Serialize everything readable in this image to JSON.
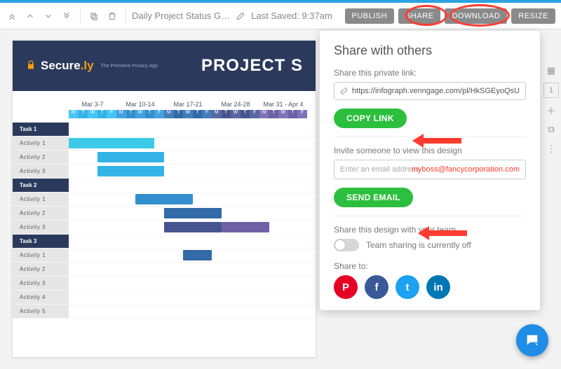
{
  "toolbar": {
    "doc_title": "Daily Project Status G…",
    "last_saved": "Last Saved: 9:37am"
  },
  "actions": {
    "publish": "PUBLISH",
    "share": "SHARE",
    "download": "DOWNLOAD",
    "resize": "RESIZE"
  },
  "design": {
    "brand_secure": "Secure",
    "brand_ly": ".ly",
    "tagline": "The Premiere Privacy App",
    "title": "PROJECT S",
    "weeks": [
      "Mar 3-7",
      "Mar 10-14",
      "Mar 17-21",
      "Mar 24-28",
      "Mar 31 - Apr 4"
    ],
    "day_letters": [
      "M",
      "T",
      "W",
      "T",
      "F"
    ],
    "week_colors": [
      "#34b4e6",
      "#338fcd",
      "#336aa8",
      "#47558f",
      "#6e60a5"
    ],
    "rows": [
      {
        "label": "Task 1",
        "type": "task"
      },
      {
        "label": "Activity 1",
        "type": "act",
        "bar": {
          "start": 0,
          "len": 9,
          "color": "#3dcae8"
        }
      },
      {
        "label": "Activity 2",
        "type": "act",
        "bar": {
          "start": 3,
          "len": 7,
          "color": "#34b4e6"
        }
      },
      {
        "label": "Activity 3",
        "type": "act",
        "bar": {
          "start": 3,
          "len": 7,
          "color": "#34b4e6"
        }
      },
      {
        "label": "Task 2",
        "type": "task"
      },
      {
        "label": "Activity 1",
        "type": "act",
        "bar": {
          "start": 7,
          "len": 6,
          "color": "#338fcd"
        }
      },
      {
        "label": "Activity 2",
        "type": "act",
        "bar": {
          "start": 10,
          "len": 6,
          "color": "#336aa8"
        }
      },
      {
        "label": "Activity 3",
        "type": "act",
        "bar": {
          "start": 10,
          "len": 11,
          "color": "#47558f",
          "alt": "#6e60a5",
          "altAt": 16
        }
      },
      {
        "label": "Task 3",
        "type": "task"
      },
      {
        "label": "Activity 1",
        "type": "act",
        "bar": {
          "start": 12,
          "len": 3,
          "color": "#336aa8"
        }
      },
      {
        "label": "Activity 2",
        "type": "act"
      },
      {
        "label": "Activity 3",
        "type": "act"
      },
      {
        "label": "Activity 4",
        "type": "act"
      },
      {
        "label": "Activity 5",
        "type": "act"
      }
    ]
  },
  "share": {
    "title": "Share with others",
    "link_label": "Share this private link:",
    "link_value": "https://infograph.venngage.com/pl/HkSGEyoQsU",
    "copy_btn": "COPY LINK",
    "invite_label": "Invite someone to view this design",
    "email_placeholder": "Enter an email address",
    "email_sample": "myboss@fancycorporation.com",
    "send_btn": "SEND EMAIL",
    "team_label": "Share this design with your team",
    "team_status": "Team sharing is currently off",
    "share_to": "Share to:",
    "social": [
      {
        "name": "pinterest",
        "bg": "#e60023",
        "glyph": "P"
      },
      {
        "name": "facebook",
        "bg": "#3b5998",
        "glyph": "f"
      },
      {
        "name": "twitter",
        "bg": "#1da1f2",
        "glyph": "t"
      },
      {
        "name": "linkedin",
        "bg": "#0077b5",
        "glyph": "in"
      }
    ]
  },
  "side": {
    "page": "1"
  }
}
